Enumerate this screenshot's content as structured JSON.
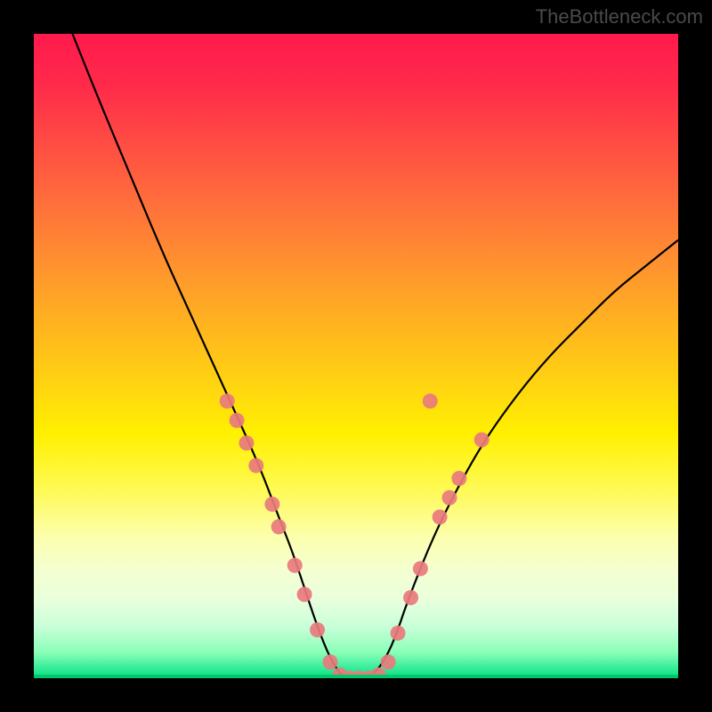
{
  "watermark": "TheBottleneck.com",
  "chart_data": {
    "type": "line",
    "title": "",
    "xlabel": "",
    "ylabel": "",
    "xlim": [
      0,
      100
    ],
    "ylim": [
      0,
      100
    ],
    "series": [
      {
        "name": "bottleneck-curve",
        "x": [
          6,
          10,
          15,
          20,
          25,
          30,
          35,
          38,
          40,
          42,
          44,
          46,
          48,
          50,
          52,
          54,
          56,
          58,
          62,
          66,
          70,
          75,
          80,
          85,
          90,
          95,
          100
        ],
        "y": [
          100,
          90,
          78,
          66,
          55,
          44,
          33,
          25,
          20,
          14,
          8,
          3,
          0,
          0,
          0,
          2,
          6,
          12,
          22,
          30,
          37,
          44,
          50,
          55,
          60,
          64,
          68
        ]
      }
    ],
    "markers": [
      {
        "x": 30.0,
        "y": 43.0
      },
      {
        "x": 31.5,
        "y": 40.0
      },
      {
        "x": 33.0,
        "y": 36.5
      },
      {
        "x": 34.5,
        "y": 33.0
      },
      {
        "x": 37.0,
        "y": 27.0
      },
      {
        "x": 38.0,
        "y": 23.5
      },
      {
        "x": 40.5,
        "y": 17.5
      },
      {
        "x": 42.0,
        "y": 13.0
      },
      {
        "x": 44.0,
        "y": 7.5
      },
      {
        "x": 46.0,
        "y": 2.5
      },
      {
        "x": 47.5,
        "y": 0.5
      },
      {
        "x": 49.0,
        "y": 0.0
      },
      {
        "x": 50.5,
        "y": 0.0
      },
      {
        "x": 52.0,
        "y": 0.0
      },
      {
        "x": 53.5,
        "y": 0.5
      },
      {
        "x": 55.0,
        "y": 2.5
      },
      {
        "x": 56.5,
        "y": 7.0
      },
      {
        "x": 58.5,
        "y": 12.5
      },
      {
        "x": 60.0,
        "y": 17.0
      },
      {
        "x": 63.0,
        "y": 25.0
      },
      {
        "x": 64.5,
        "y": 28.0
      },
      {
        "x": 66.0,
        "y": 31.0
      },
      {
        "x": 69.5,
        "y": 37.0
      },
      {
        "x": 61.5,
        "y": 43.0
      }
    ],
    "marker_color": "#e97a7d",
    "curve_color": "#000000",
    "background_gradient": [
      "#ff1a4d",
      "#fff000",
      "#00e085"
    ]
  }
}
